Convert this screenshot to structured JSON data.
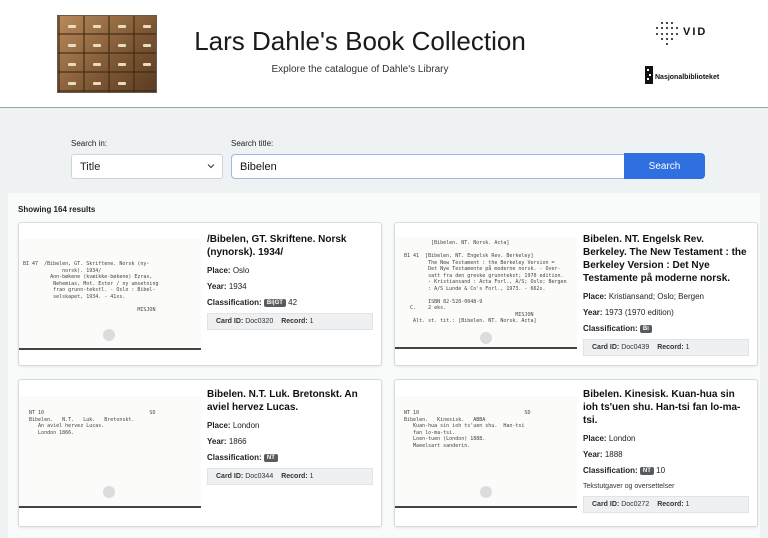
{
  "header": {
    "title": "Lars Dahle's Book Collection",
    "subtitle": "Explore the catalogue of Dahle's Library",
    "logo_vid": "VID",
    "logo_nb": "Nasjonalbiblioteket"
  },
  "search": {
    "in_label": "Search in:",
    "field_selected": "Title",
    "title_label": "Search title:",
    "query": "Bibelen",
    "button_label": "Search"
  },
  "results": {
    "count_text": "Showing 164 results",
    "place_label": "Place:",
    "year_label": "Year:",
    "class_label": "Classification:",
    "cardid_label": "Card ID:",
    "record_label": "Record:",
    "items": [
      {
        "title": "/Bibelen, GT. Skriftene. Norsk (nynorsk). 1934/",
        "place": "Oslo",
        "year": "1934",
        "badge": "Bi|GT",
        "class_num": "42",
        "card_id": "Doc0320",
        "record": "1",
        "card_text": "BI 47  /Bibelen, GT. Skriftene. Norsk (ny-\n             norsk). 1934/\n         Ann-bøkene (kvæikke-bøkene) Ezras,\n          Nehemias, Mot. Ester / ny umsetning\n          frao grunn-tekstl. - Oslo : Bibel-\n          selskapet, 1934. - 41xs.\n\n                                      MISJON"
      },
      {
        "title": "Bibelen. NT. Engelsk Rev. Berkeley. The New Testament : the Berkeley Version : Det Nye Testamente på moderne norsk.",
        "place": "Kristiansand; Oslo; Bergen",
        "year": "1973 (1970 edition)",
        "badge": "Bi",
        "card_id": "Doc0439",
        "record": "1",
        "card_text": "           [Bibelen. NT. Norsk. Acta]\n      \n  B1 41  [Bibelen, NT. Engelsk Rev. Berkeley]\n          The New Testament : the Berkeley Version = \n          Det Nye Testamente på moderne norsk. - Over-\n          satt fra den greske grunntekst; 1970 edition.\n          - Kristiansand : Acta Forl., A/S; Oslo; Bergen\n          : A/S Lunde & Co's Forl., 1973. - 662s.\n\n          ISBN 82-520-0048-9\n    C.    2 eks.\n                                       MISJON\n     Alt. st. tit.: [Bibelen. NT. Norsk. Acta]"
      },
      {
        "title": "Bibelen. N.T. Luk. Bretonskt. An aviel hervez Lucas.",
        "place": "London",
        "year": "1866",
        "badge": "NT",
        "card_id": "Doc0344",
        "record": "1",
        "card_text": "  NT 10                                   SD\n  Bibelen.   N.T.   Luk.   Bretonskt.\n     An aviel hervez Lucas.\n     London 1866."
      },
      {
        "title": "Bibelen. Kinesisk. Kuan-hua sin ioh ts'uen shu. Han-tsi fan lo-ma-tsi.",
        "place": "London",
        "year": "1888",
        "badge": "NT",
        "class_num": "10",
        "note": "Tekstutgaver og oversettelser",
        "card_id": "Doc0272",
        "record": "1",
        "card_text": "  NT 10                                   SD\n  Bibelen.   Kinesisk.   ABBA\n     Kuan-hua sin ioh ts'uen shu.  Han-tsi\n     fan lo-ma-tsi.\n     Loen-tuen (London) 1888.\n     Maeelsart sanderin."
      }
    ]
  },
  "colors": {
    "primary": "#2f6fe0",
    "badge": "#575c61",
    "page_bg": "#eef2f3"
  }
}
